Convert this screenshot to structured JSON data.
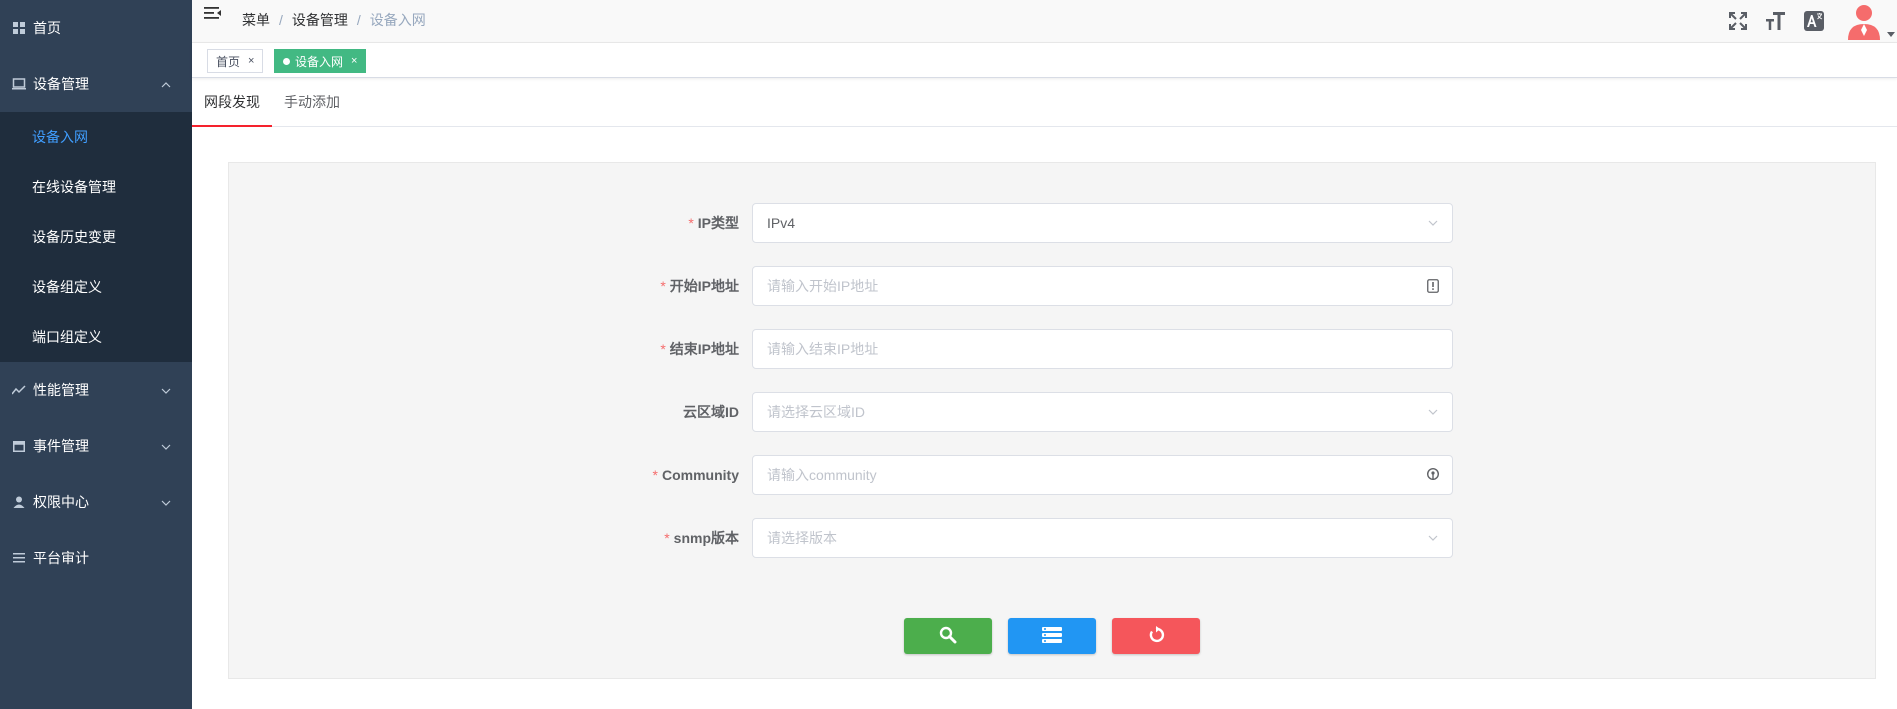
{
  "sidebar": {
    "items": [
      {
        "label": "首页",
        "icon": "dashboard-icon"
      },
      {
        "label": "设备管理",
        "icon": "monitor-icon",
        "expanded": true,
        "children": [
          {
            "label": "设备入网",
            "active": true
          },
          {
            "label": "在线设备管理"
          },
          {
            "label": "设备历史变更"
          },
          {
            "label": "设备组定义"
          },
          {
            "label": "端口组定义"
          }
        ]
      },
      {
        "label": "性能管理",
        "icon": "chart-line-icon"
      },
      {
        "label": "事件管理",
        "icon": "calendar-icon"
      },
      {
        "label": "权限中心",
        "icon": "user-icon"
      },
      {
        "label": "平台审计",
        "icon": "list-icon"
      }
    ]
  },
  "navbar": {
    "breadcrumb": [
      "菜单",
      "设备管理",
      "设备入网"
    ],
    "separator": "/",
    "icons": [
      "fullscreen-icon",
      "font-size-icon",
      "translate-icon",
      "avatar"
    ]
  },
  "tags": [
    {
      "label": "首页",
      "close": "×",
      "active": false
    },
    {
      "label": "设备入网",
      "close": "×",
      "active": true
    }
  ],
  "tabs": [
    {
      "label": "网段发现",
      "active": true
    },
    {
      "label": "手动添加",
      "active": false
    }
  ],
  "form": {
    "required_mark": "*",
    "fields": [
      {
        "label": "IP类型",
        "required": true,
        "value": "IPv4",
        "placeholder": "",
        "suffix": "chevron-down-icon"
      },
      {
        "label": "开始IP地址",
        "required": true,
        "value": "",
        "placeholder": "请输入开始IP地址",
        "suffix": "info-icon"
      },
      {
        "label": "结束IP地址",
        "required": true,
        "value": "",
        "placeholder": "请输入结束IP地址",
        "suffix": ""
      },
      {
        "label": "云区域ID",
        "required": false,
        "value": "",
        "placeholder": "请选择云区域ID",
        "suffix": "chevron-down-icon"
      },
      {
        "label": "Community",
        "required": true,
        "value": "",
        "placeholder": "请输入community",
        "suffix": "key-icon"
      },
      {
        "label": "snmp版本",
        "required": true,
        "value": "",
        "placeholder": "请选择版本",
        "suffix": "chevron-down-icon"
      }
    ]
  },
  "buttons": [
    {
      "icon": "search-icon",
      "color": "#4cae4c"
    },
    {
      "icon": "list-icon",
      "color": "#2196f3"
    },
    {
      "icon": "reset-icon",
      "color": "#f5565b"
    }
  ],
  "colors": {
    "sidebar_bg": "#304156",
    "submenu_bg": "#1f2d3d",
    "active_menu": "#409eff",
    "active_tag": "#42b983",
    "required": "#f56c6c",
    "tab_underline": "#f5222d"
  }
}
